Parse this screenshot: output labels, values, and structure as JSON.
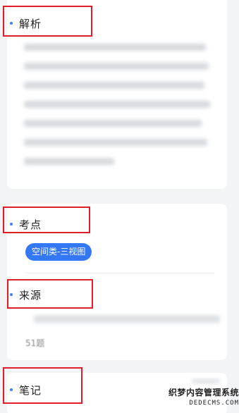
{
  "sections": {
    "analysis": {
      "title": "解析"
    },
    "exam_point": {
      "title": "考点",
      "tags": [
        "空间类-三视图"
      ]
    },
    "source": {
      "title": "来源",
      "count_text": "51题"
    },
    "notes": {
      "title": "笔记"
    }
  },
  "watermark": {
    "line1": "织梦内容管理系统",
    "line2": "DEDECMS.COM"
  },
  "colors": {
    "accent": "#3478f6",
    "highlight_box": "#e11d2a",
    "bullet": "#3b82f6"
  }
}
